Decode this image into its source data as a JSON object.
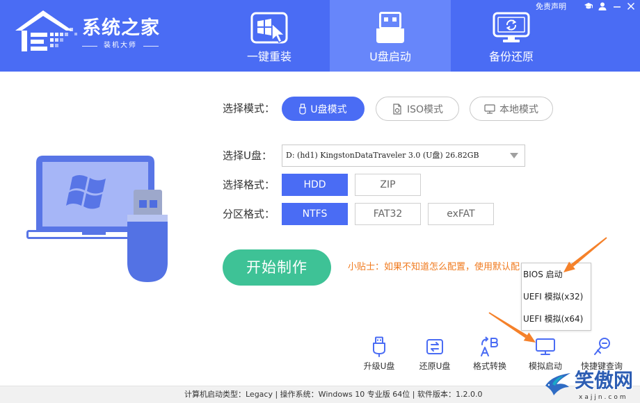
{
  "theme": {
    "header": "#4a6cf4",
    "tab_active": "#6786fa",
    "primary": "#4a6cf4",
    "start_button": "#3ec296",
    "tip_text": "#f07a1e",
    "annotation_arrow": "#f5812a",
    "illustration_blue": "#5875e6",
    "illustration_screen": "#a6b6f7",
    "usb_head": "#9da8cb"
  },
  "brand": {
    "name": "系统之家",
    "subtitle": "装机大师",
    "icon": "house-logo-icon"
  },
  "window_controls": {
    "disclaimer": "免责声明",
    "icons": [
      "graduation-cap-icon",
      "user-icon",
      "minimize-icon",
      "close-icon"
    ]
  },
  "nav_tabs": [
    {
      "label": "一键重装",
      "icon": "windows-install-icon",
      "active": false
    },
    {
      "label": "U盘启动",
      "icon": "usb-drive-icon",
      "active": true
    },
    {
      "label": "备份还原",
      "icon": "backup-restore-icon",
      "active": false
    }
  ],
  "form": {
    "mode_label": "选择模式：",
    "modes": [
      {
        "label": "U盘模式",
        "icon": "usb-icon",
        "selected": true
      },
      {
        "label": "ISO模式",
        "icon": "iso-file-icon",
        "selected": false
      },
      {
        "label": "本地模式",
        "icon": "monitor-icon",
        "selected": false
      }
    ],
    "usb_label": "选择U盘：",
    "usb_value": "D: (hd1) KingstonDataTraveler 3.0 (U盘) 26.82GB",
    "format_label": "选择格式：",
    "formats": [
      {
        "label": "HDD",
        "selected": true
      },
      {
        "label": "ZIP",
        "selected": false
      }
    ],
    "partition_label": "分区格式：",
    "partitions": [
      {
        "label": "NTFS",
        "selected": true
      },
      {
        "label": "FAT32",
        "selected": false
      },
      {
        "label": "exFAT",
        "selected": false
      }
    ],
    "start_label": "开始制作",
    "tip": "小贴士：如果不知道怎么配置，使用默认配"
  },
  "boot_menu": {
    "items": [
      "BIOS 启动",
      "UEFI 模拟(x32)",
      "UEFI 模拟(x64)"
    ]
  },
  "tools": [
    {
      "label": "升级U盘",
      "icon": "usb-upgrade-icon"
    },
    {
      "label": "还原U盘",
      "icon": "usb-restore-icon"
    },
    {
      "label": "格式转换",
      "icon": "format-convert-icon"
    },
    {
      "label": "模拟启动",
      "icon": "simulate-boot-icon"
    },
    {
      "label": "快捷键查询",
      "icon": "hotkey-search-icon"
    }
  ],
  "status_bar": {
    "text": "计算机启动类型：Legacy | 操作系统：Windows 10 专业版 64位 | 软件版本：1.2.0.0"
  },
  "watermark": {
    "name": "笑傲网",
    "domain": "xajjn.com"
  }
}
